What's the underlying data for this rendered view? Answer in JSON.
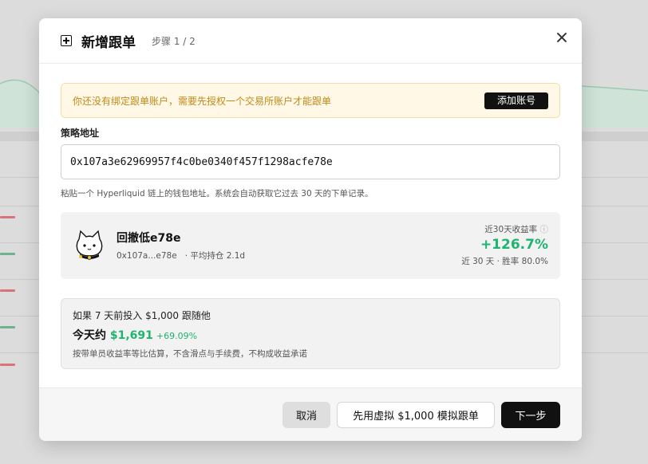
{
  "modal": {
    "title": "新增跟单",
    "step": "步骤 1 / 2"
  },
  "notice": {
    "text": "你还没有绑定跟单账户，需要先授权一个交易所账户才能跟单",
    "button_label": "添加账号"
  },
  "address": {
    "label": "策略地址",
    "value": "0x107a3e62969957f4c0be0340f457f1298acfe78e",
    "hint": "粘贴一个 Hyperliquid 链上的钱包地址。系统会自动获取它过去 30 天的下单记录。"
  },
  "trader": {
    "name": "回撤低e78e",
    "address_short": "0x107a...e78e",
    "meta": "· 平均持仓 2.1d",
    "return_label": "近30天收益率",
    "info_icon": "info-icon",
    "return_value": "+126.7%",
    "sub": "近 30 天 · 胜率 80.0%"
  },
  "simulation": {
    "question": "如果 7 天前投入 $1,000 跟随他",
    "today_label": "今天约",
    "amount": "$1,691",
    "pct": "+69.09%",
    "note": "按带单员收益率等比估算，不含滑点与手续费，不构成收益承诺"
  },
  "footer": {
    "cancel_label": "取消",
    "demo_label": "先用虚拟 $1,000 模拟跟单",
    "next_label": "下一步"
  },
  "colors": {
    "accent_green": "#1fb46f",
    "notice_text": "#c08a1a",
    "notice_bg": "#fff8e6",
    "primary": "#111111"
  }
}
